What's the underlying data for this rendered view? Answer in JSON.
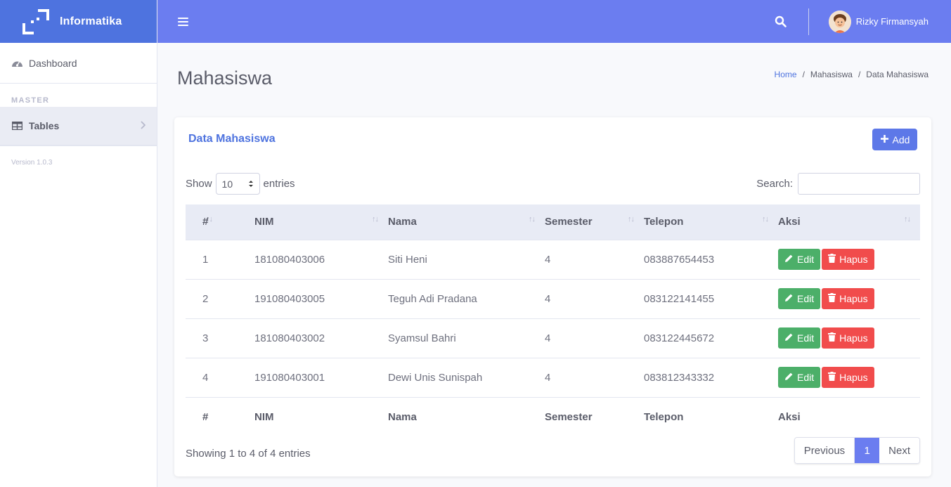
{
  "brand": {
    "name": "Informatika"
  },
  "sidebar": {
    "dashboard_label": "Dashboard",
    "heading": "MASTER",
    "tables_label": "Tables",
    "version": "Version 1.0.3"
  },
  "topbar": {
    "user_name": "Rizky Firmansyah"
  },
  "page": {
    "title": "Mahasiswa"
  },
  "breadcrumb": {
    "home": "Home",
    "sep1": "/",
    "mid": "Mahasiswa",
    "sep2": "/",
    "current": "Data Mahasiswa"
  },
  "card": {
    "title": "Data Mahasiswa",
    "add_label": "Add"
  },
  "datatable": {
    "show_label": "Show",
    "length_value": "10",
    "entries_label": "entries",
    "search_label": "Search:",
    "columns": [
      "#",
      "NIM",
      "Nama",
      "Semester",
      "Telepon",
      "Aksi"
    ],
    "rows": [
      {
        "no": "1",
        "nim": "181080403006",
        "nama": "Siti Heni",
        "semester": "4",
        "telepon": "083887654453"
      },
      {
        "no": "2",
        "nim": "191080403005",
        "nama": "Teguh Adi Pradana",
        "semester": "4",
        "telepon": "083122141455"
      },
      {
        "no": "3",
        "nim": "181080403002",
        "nama": "Syamsul Bahri",
        "semester": "4",
        "telepon": "083122445672"
      },
      {
        "no": "4",
        "nim": "191080403001",
        "nama": "Dewi Unis Sunispah",
        "semester": "4",
        "telepon": "083812343332"
      }
    ],
    "edit_label": "Edit",
    "delete_label": "Hapus",
    "info": "Showing 1 to 4 of 4 entries",
    "pagination": {
      "previous": "Previous",
      "current": "1",
      "next": "Next"
    }
  },
  "colors": {
    "primary": "#4e73df",
    "topbar": "#6b7df0",
    "success": "#4caf69",
    "danger": "#f14c4c"
  }
}
